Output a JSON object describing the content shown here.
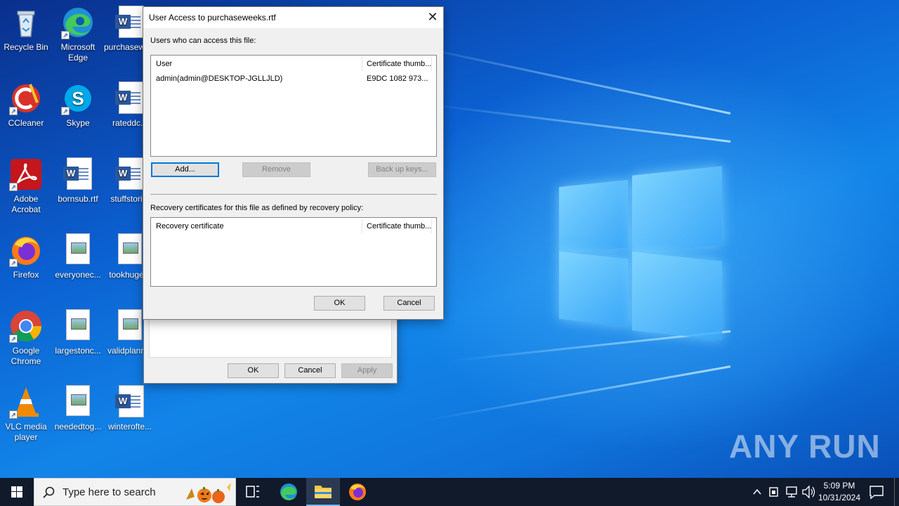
{
  "desktop": {
    "icons": [
      {
        "label": "Recycle Bin"
      },
      {
        "label": "Microsoft Edge"
      },
      {
        "label": "purchaseweeks.rtf"
      },
      {
        "label": "CCleaner"
      },
      {
        "label": "Skype"
      },
      {
        "label": "rateddc..."
      },
      {
        "label": "Adobe Acrobat"
      },
      {
        "label": "bornsub.rtf"
      },
      {
        "label": "stuffstori..."
      },
      {
        "label": "Firefox"
      },
      {
        "label": "everyonec..."
      },
      {
        "label": "tookhuge..."
      },
      {
        "label": "Google Chrome"
      },
      {
        "label": "largestonc..."
      },
      {
        "label": "validplann..."
      },
      {
        "label": "VLC media player"
      },
      {
        "label": "neededtog..."
      },
      {
        "label": "winterofte..."
      }
    ],
    "watermark": "ANY RUN"
  },
  "back_dialog": {
    "ok": "OK",
    "cancel": "Cancel",
    "apply": "Apply"
  },
  "user_access_dialog": {
    "title": "User Access to purchaseweeks.rtf",
    "users_label": "Users who can access this file:",
    "users_columns": [
      "User",
      "Certificate thumb..."
    ],
    "users_rows": [
      {
        "user": "admin(admin@DESKTOP-JGLLJLD)",
        "thumb": "E9DC 1082 973..."
      }
    ],
    "add_button": "Add...",
    "remove_button": "Remove",
    "backup_button": "Back up keys...",
    "recovery_label": "Recovery certificates for this file as defined by recovery policy:",
    "recovery_columns": [
      "Recovery certificate",
      "Certificate thumb..."
    ],
    "ok": "OK",
    "cancel": "Cancel"
  },
  "taskbar": {
    "search_placeholder": "Type here to search",
    "time": "5:09 PM",
    "date": "10/31/2024"
  }
}
